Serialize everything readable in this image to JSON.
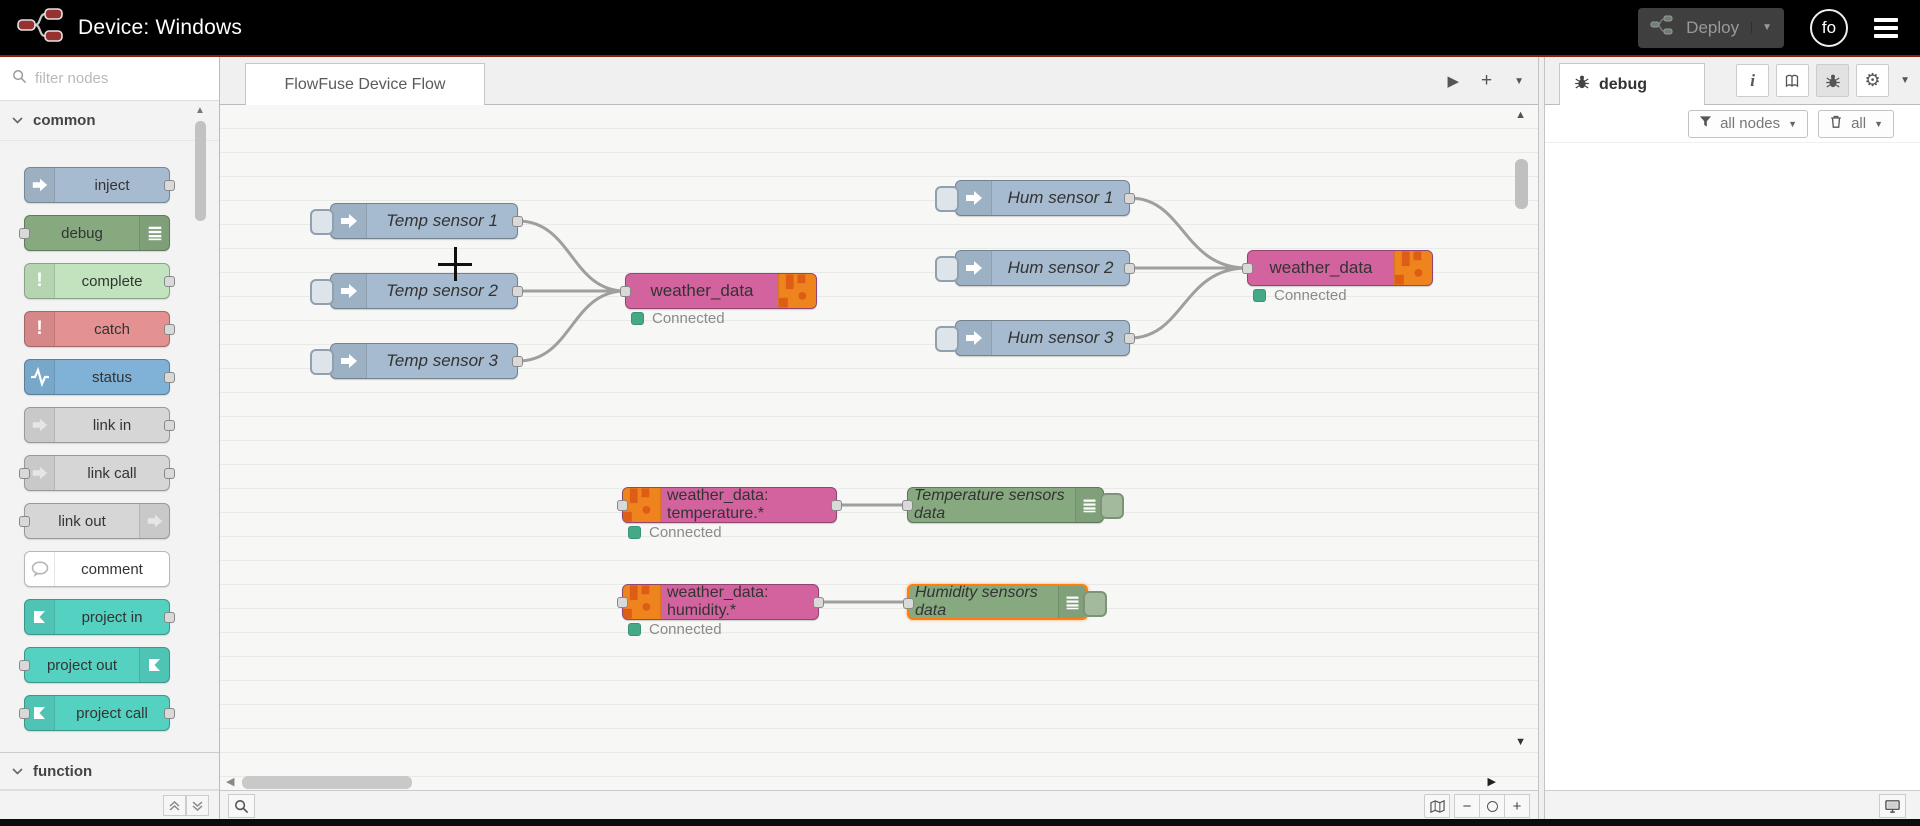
{
  "header": {
    "title": "Device: Windows",
    "deploy_label": "Deploy",
    "avatar_initials": "fo"
  },
  "palette": {
    "filter_placeholder": "filter nodes",
    "categories": {
      "common": "common",
      "function": "function"
    },
    "nodes": [
      "inject",
      "debug",
      "complete",
      "catch",
      "status",
      "link in",
      "link call",
      "link out",
      "comment",
      "project in",
      "project out",
      "project call"
    ]
  },
  "workspace": {
    "tab_label": "FlowFuse Device Flow"
  },
  "canvas": {
    "status_connected": "Connected",
    "nodes": {
      "temp1": "Temp sensor 1",
      "temp2": "Temp sensor 2",
      "temp3": "Temp sensor 3",
      "hum1": "Hum sensor 1",
      "hum2": "Hum sensor 2",
      "hum3": "Hum sensor 3",
      "wd_left": "weather_data",
      "wd_right": "weather_data",
      "wd_temp": "weather_data: temperature.*",
      "wd_hum": "weather_data: humidity.*",
      "debug_temp": "Temperature sensors data",
      "debug_hum": "Humidity sensors data"
    }
  },
  "debug_panel": {
    "tab_label": "debug",
    "filter_label": "all nodes",
    "clear_label": "all"
  },
  "colors": {
    "accent_red": "#8f1d14",
    "node_blue": "#a6bbcf",
    "node_green": "#87a980",
    "node_pink": "#d2639e",
    "node_teal": "#54d1c1",
    "flowfuse_orange": "#f5821f",
    "status_green": "#45a887",
    "selection_orange": "#ff7f0e"
  }
}
